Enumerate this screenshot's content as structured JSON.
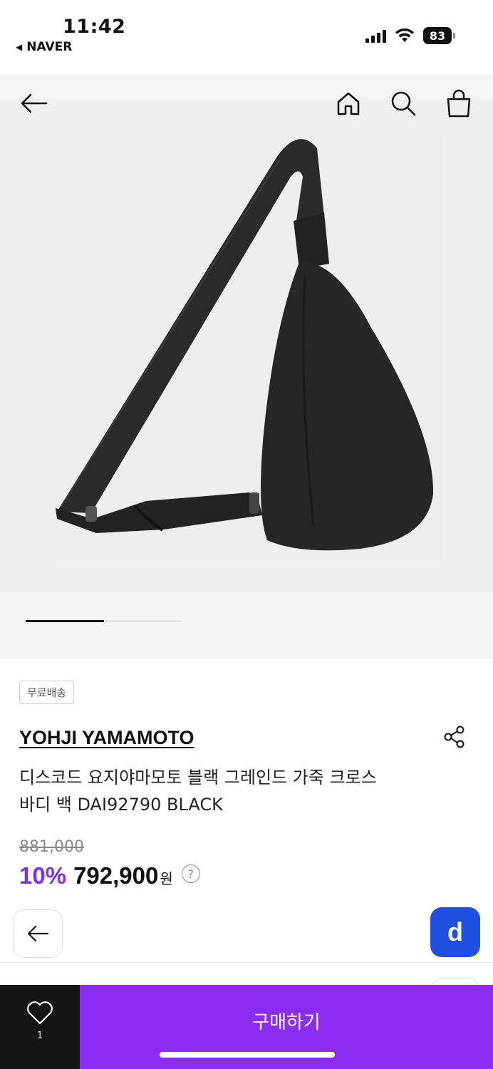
{
  "status_bar": {
    "time": "11:42",
    "back_app": "NAVER",
    "battery": "83",
    "icons": [
      "cellular-signal-icon",
      "wifi-icon",
      "battery-icon"
    ]
  },
  "nav": {
    "icons": [
      "back-arrow-icon",
      "home-icon",
      "search-icon",
      "shopping-bag-icon"
    ]
  },
  "gallery": {
    "image_description": "black leather crossbody sling bag",
    "current_index": 1
  },
  "product": {
    "badge": "무료배송",
    "brand": "YOHJI YAMAMOTO",
    "title": "디스코드 요지야마모토 블랙 그레인드 가죽 크로스바디 백 DAI92790 BLACK",
    "original_price": "881,000",
    "discount": "10%",
    "price": "792,900",
    "currency": "원",
    "help": "?"
  },
  "floating": {
    "d_label": "d"
  },
  "bottom_bar": {
    "wish_count": "1",
    "buy_label": "구매하기"
  },
  "colors": {
    "accent_purple": "#8a2cf2",
    "discount_purple": "#7b2ff2",
    "d_blue": "#1f4fe0",
    "wish_bg": "#151515"
  }
}
